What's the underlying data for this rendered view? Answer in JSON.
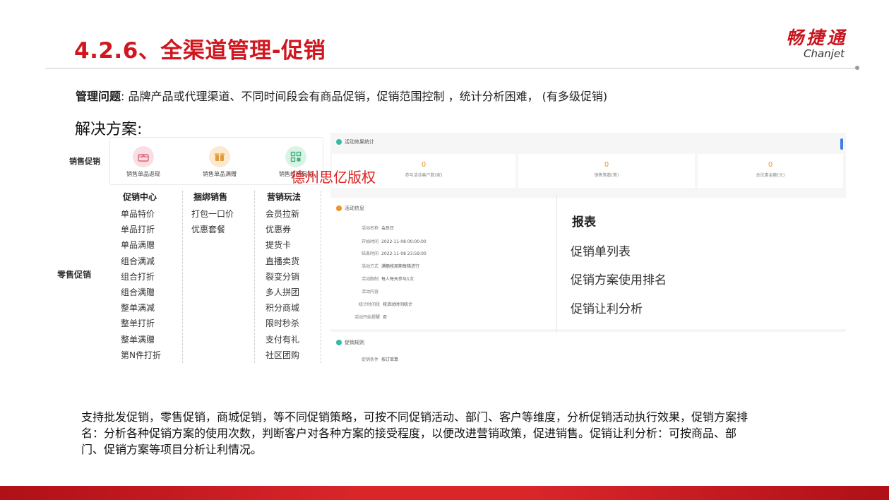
{
  "slide": {
    "title": "4.2.6、全渠道管理-促销",
    "logo_cn": "畅捷通",
    "logo_en": "Chanjet"
  },
  "problem": {
    "label": "管理问题",
    "text": ": 品牌产品或代理渠道、不同时间段会有商品促销，促销范围控制 ，统计分析困难， (有多级促销)"
  },
  "solution_heading": "解决方案:",
  "promo_menu": {
    "wholesale_label": "销售促销",
    "wholesale_items": [
      {
        "label": "销售单品返现",
        "icon": "gift-icon",
        "color": "#f7dfe4",
        "accent": "#e0607a"
      },
      {
        "label": "销售单品满赠",
        "icon": "box-icon",
        "color": "#fbe9d0",
        "accent": "#e29a3b"
      },
      {
        "label": "销售组合促销",
        "icon": "grid-icon",
        "color": "#dbf3e6",
        "accent": "#39b37a"
      }
    ],
    "retail_label": "零售促销",
    "columns": [
      {
        "heading": "促销中心",
        "items": [
          "单品特价",
          "单品打折",
          "单品满赠",
          "组合满减",
          "组合打折",
          "组合满赠",
          "整单满减",
          "整单打折",
          "整单满赠",
          "第N件打折"
        ]
      },
      {
        "heading": "捆绑销售",
        "items": [
          "打包一口价",
          "优惠套餐"
        ]
      },
      {
        "heading": "营销玩法",
        "items": [
          "会员拉新",
          "优惠券",
          "提货卡",
          "直播卖货",
          "裂变分销",
          "多人拼团",
          "积分商城",
          "限时秒杀",
          "支付有礼",
          "社区团购"
        ]
      }
    ]
  },
  "watermark": "德州思亿版权",
  "stats_panel": {
    "heading": "活动效果统计",
    "cards": [
      {
        "value": "0",
        "label": "参与活动客户数(家)"
      },
      {
        "value": "0",
        "label": "销售笔数(笔)"
      },
      {
        "value": "0",
        "label": "总优惠金额(元)"
      }
    ],
    "detail_heading": "活动信息",
    "details": [
      {
        "label": "活动名称",
        "value": "会员日"
      },
      {
        "label": "开始时间",
        "value": "2022-11-08 00:00:00"
      },
      {
        "label": "结束时间",
        "value": "2022-11-08 23:59:00"
      },
      {
        "label": "活动方式",
        "value": "满额按周期每梯进行"
      },
      {
        "label": "活动限制",
        "value": "每人每天参与1次"
      },
      {
        "label": "活动内容",
        "value": ""
      },
      {
        "label": "统计时间段",
        "value": "按活动时间统计"
      },
      {
        "label": "活动开始提醒",
        "value": "否"
      }
    ],
    "rule_heading": "促销规则",
    "rule_row": {
      "label": "促销条件",
      "value": "按订单算"
    }
  },
  "report": {
    "title": "报表",
    "items": [
      "促销单列表",
      "促销方案使用排名",
      "促销让利分析"
    ]
  },
  "summary": "支持批发促销，零售促销，商城促销，等不同促销策略，可按不同促销活动、部门、客户等维度，分析促销活动执行效果，促销方案排名：分析各种促销方案的使用次数，判断客户对各种方案的接受程度，以便改进营销政策，促进销售。促销让利分析：可按商品、部门、促销方案等项目分析让利情况。",
  "colors": {
    "title_red": "#d0161e",
    "stat_orange": "#f0932b",
    "teal": "#35b9a8",
    "footer_red": "#d8262b"
  }
}
